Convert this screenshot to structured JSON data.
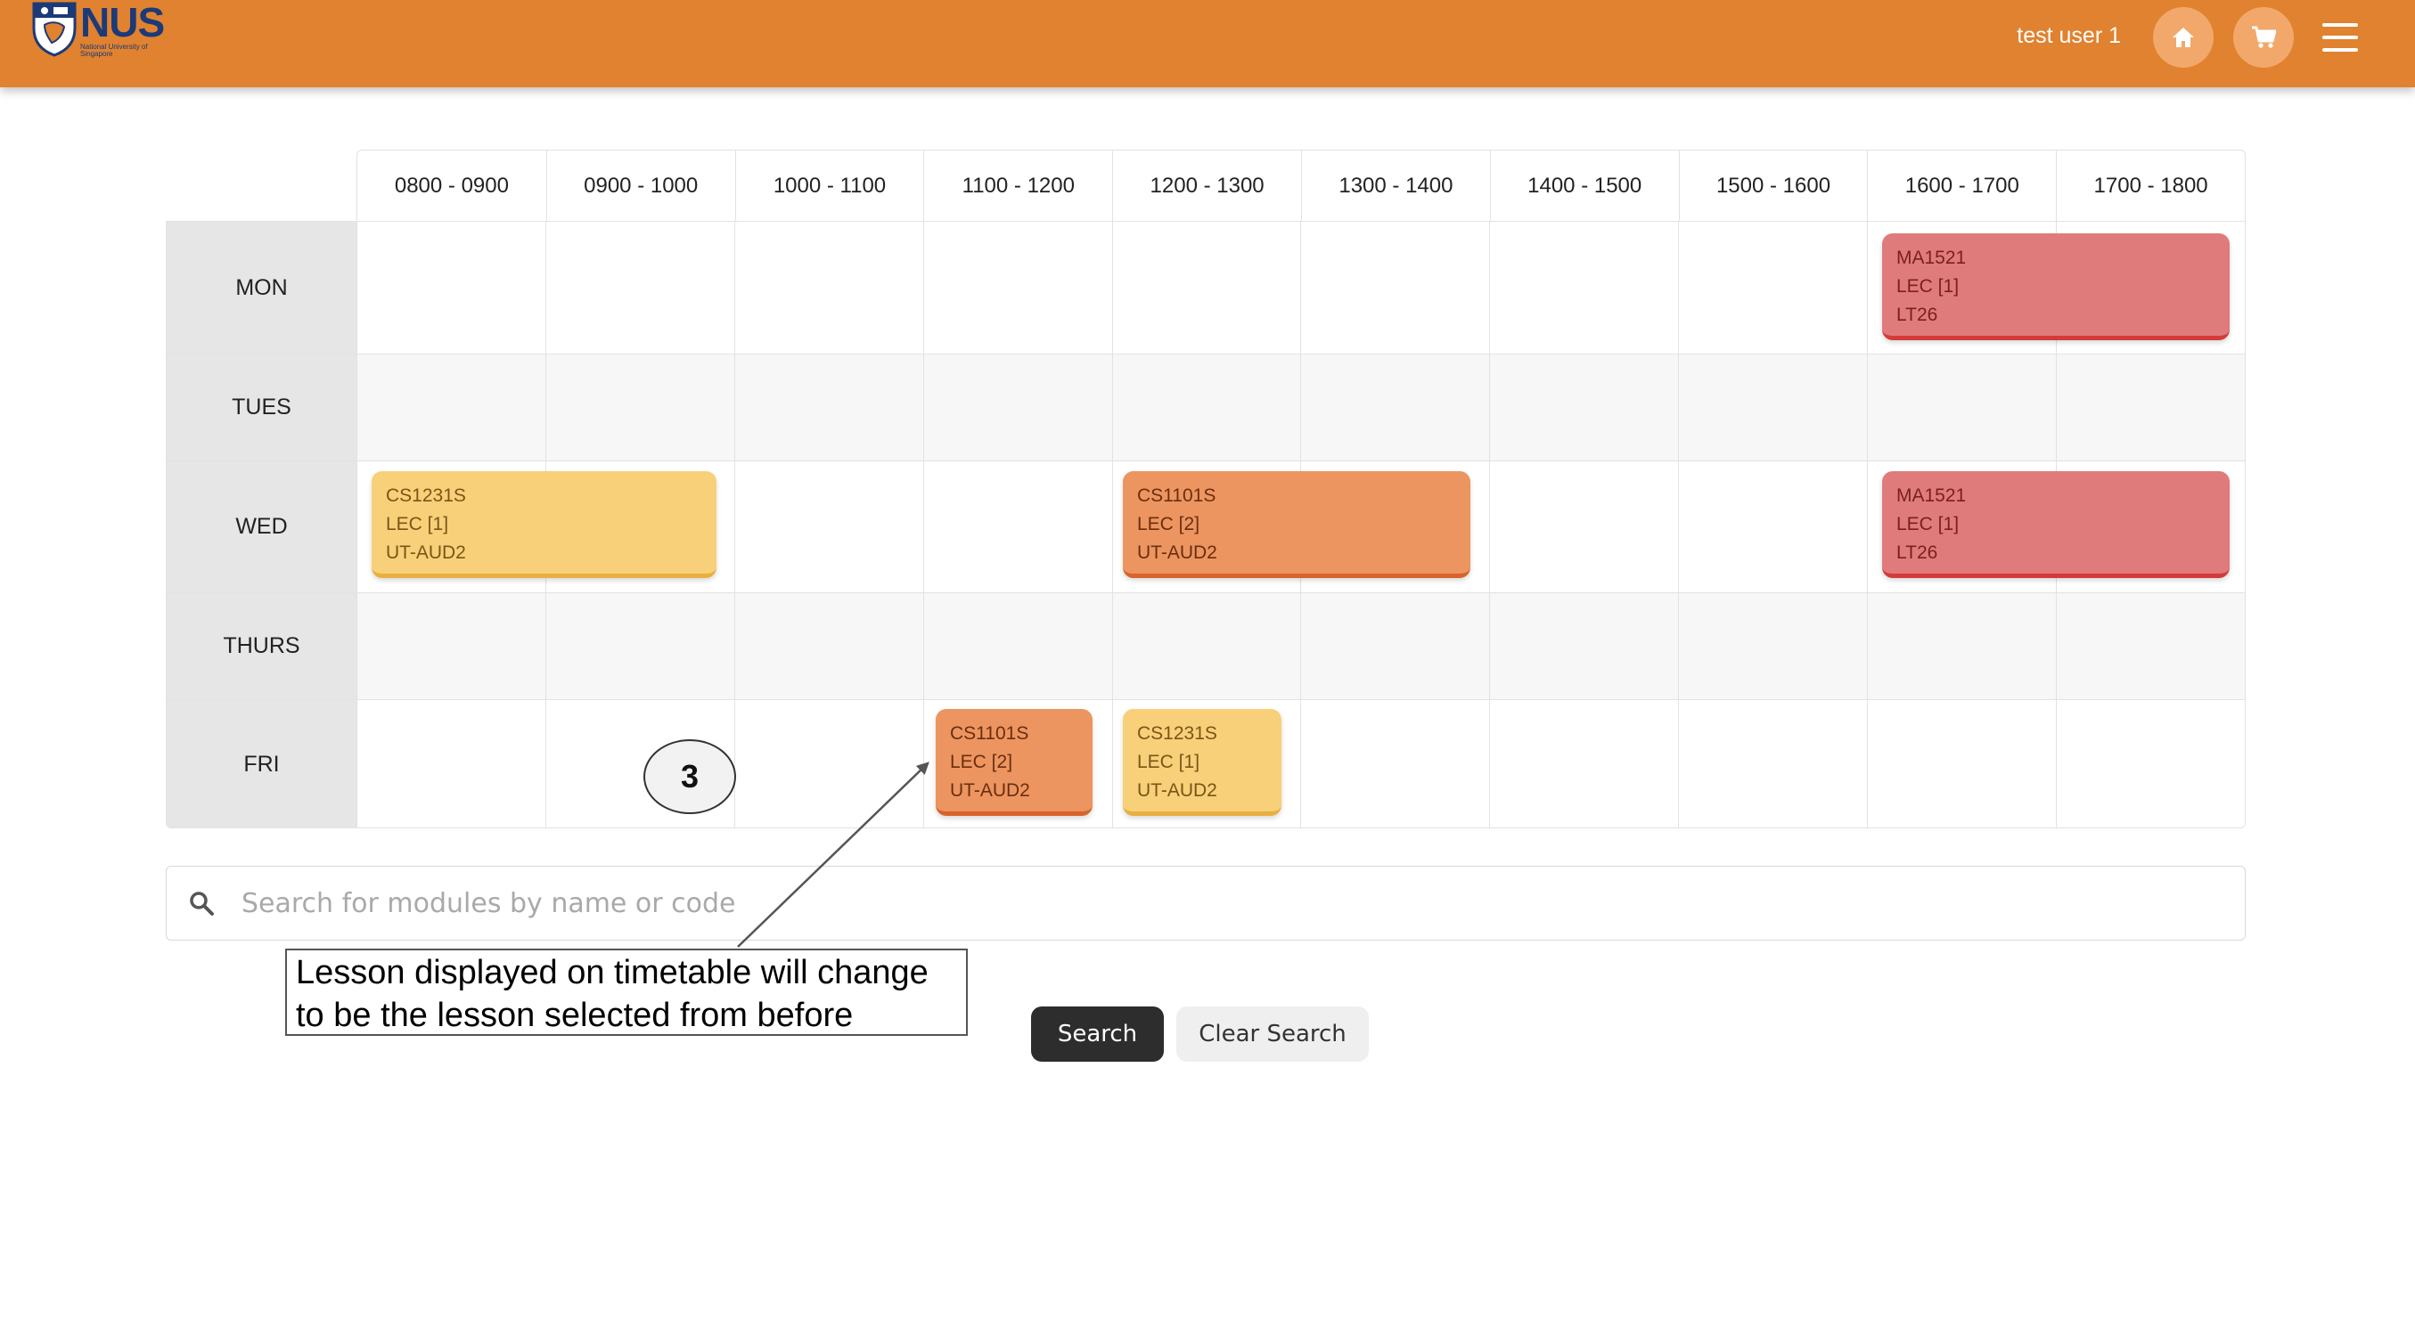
{
  "header": {
    "logo_text": "NUS",
    "logo_subtitle": "National University of Singapore",
    "user_name": "test user 1",
    "accent_color": "#e0822f",
    "icons": [
      "home-icon",
      "cart-icon",
      "hamburger-menu-icon"
    ]
  },
  "timetable": {
    "time_slots": [
      "0800 - 0900",
      "0900 - 1000",
      "1000 - 1100",
      "1100 - 1200",
      "1200 - 1300",
      "1300 - 1400",
      "1400 - 1500",
      "1500 - 1600",
      "1600 - 1700",
      "1700 - 1800"
    ],
    "days": [
      "MON",
      "TUES",
      "WED",
      "THURS",
      "FRI"
    ],
    "lessons": [
      {
        "day": "MON",
        "start": "1600",
        "end": "1800",
        "code": "MA1521",
        "type": "LEC [1]",
        "venue": "LT26",
        "color": "#e07b7b"
      },
      {
        "day": "WED",
        "start": "0800",
        "end": "1000",
        "code": "CS1231S",
        "type": "LEC [1]",
        "venue": "UT-AUD2",
        "color": "#f8d079"
      },
      {
        "day": "WED",
        "start": "1200",
        "end": "1400",
        "code": "CS1101S",
        "type": "LEC [2]",
        "venue": "UT-AUD2",
        "color": "#ec9560"
      },
      {
        "day": "WED",
        "start": "1600",
        "end": "1800",
        "code": "MA1521",
        "type": "LEC [1]",
        "venue": "LT26",
        "color": "#e07b7b"
      },
      {
        "day": "FRI",
        "start": "1100",
        "end": "1200",
        "code": "CS1101S",
        "type": "LEC [2]",
        "venue": "UT-AUD2",
        "color": "#ec9560"
      },
      {
        "day": "FRI",
        "start": "1200",
        "end": "1300",
        "code": "CS1231S",
        "type": "LEC [1]",
        "venue": "UT-AUD2",
        "color": "#f8d079"
      }
    ]
  },
  "search": {
    "placeholder": "Search for modules by name or code",
    "value": "",
    "search_label": "Search",
    "clear_label": "Clear Search"
  },
  "annotation": {
    "step": "3",
    "line1": "Lesson displayed on timetable will change",
    "line2": "to be the lesson selected from before"
  }
}
